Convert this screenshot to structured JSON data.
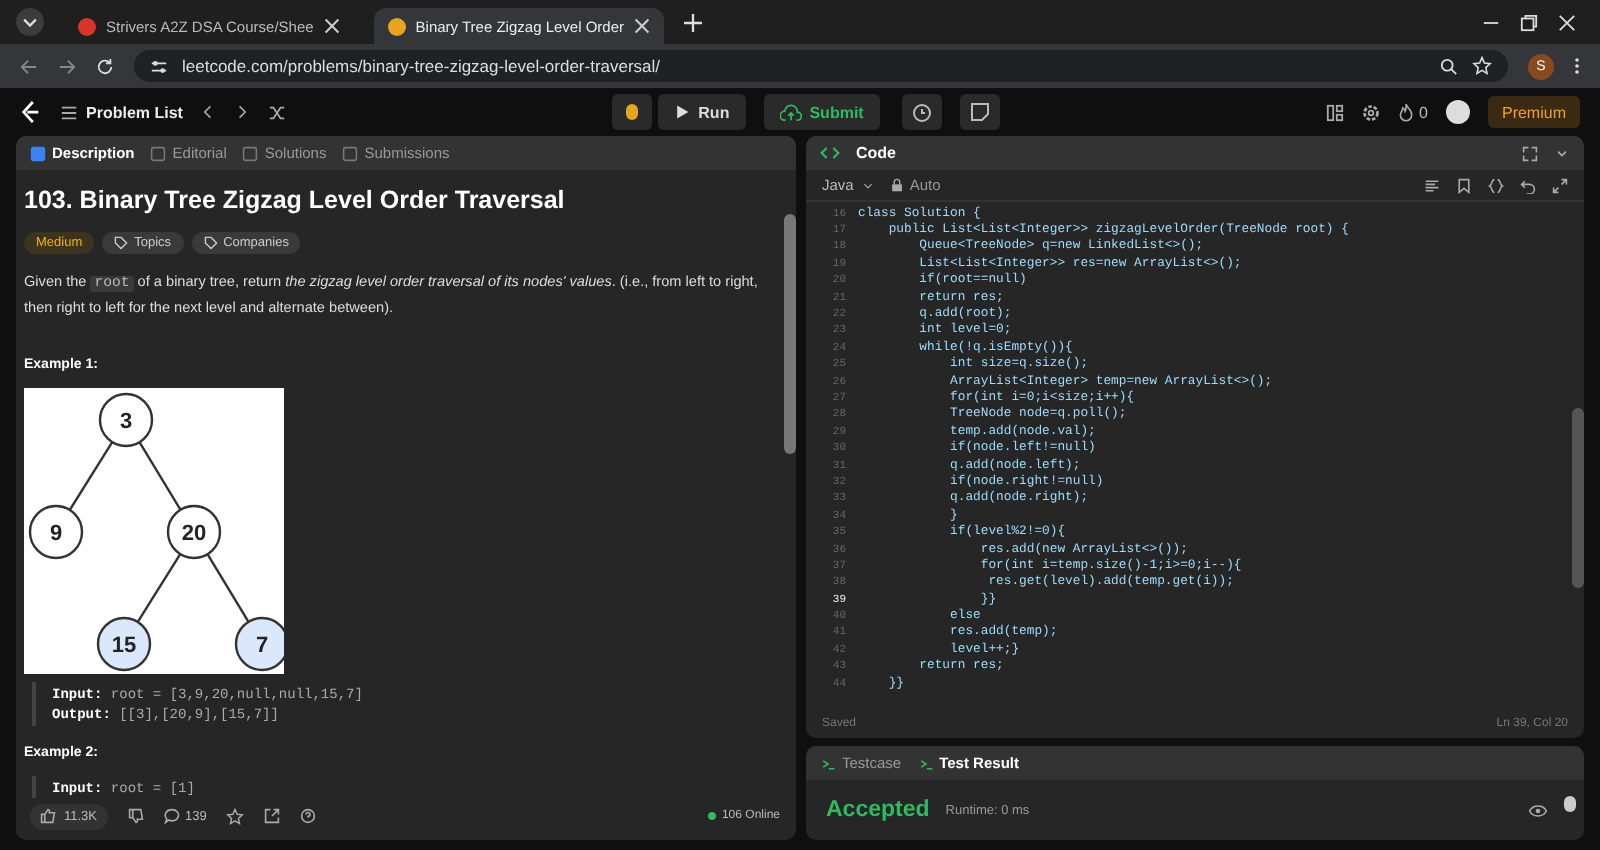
{
  "browser": {
    "tabs": [
      {
        "title": "Strivers A2Z DSA Course/Shee",
        "selected": false
      },
      {
        "title": "Binary Tree Zigzag Level Order",
        "selected": true
      }
    ],
    "url": "leetcode.com/problems/binary-tree-zigzag-level-order-traversal/",
    "profile": "S"
  },
  "topbar": {
    "problem_list": "Problem List",
    "run": "Run",
    "submit": "Submit",
    "streak": "0",
    "premium": "Premium"
  },
  "description": {
    "tabs": [
      {
        "label": "Description",
        "selected": true
      },
      {
        "label": "Editorial",
        "selected": false
      },
      {
        "label": "Solutions",
        "selected": false
      },
      {
        "label": "Submissions",
        "selected": false
      }
    ],
    "title": "103. Binary Tree Zigzag Level Order Traversal",
    "difficulty": "Medium",
    "tags": [
      "Topics",
      "Companies"
    ],
    "statement": [
      {
        "kind": "text",
        "text": "Given the "
      },
      {
        "kind": "code",
        "text": "root"
      },
      {
        "kind": "text",
        "text": " of a binary tree, return "
      },
      {
        "kind": "italic",
        "text": "the zigzag level order traversal of its nodes' values"
      },
      {
        "kind": "text",
        "text": ". (i.e., from left to right, then right to left for the next level and alternate between)."
      }
    ],
    "example1": {
      "label": "Example 1:",
      "tree": {
        "value": "3",
        "color": "#ffffff",
        "children": [
          {
            "value": "9",
            "color": "#ffffff"
          },
          {
            "value": "20",
            "color": "#ffffff",
            "children": [
              {
                "value": "15",
                "color": "#dbe8fb"
              },
              {
                "value": "7",
                "color": "#dbe8fb"
              }
            ]
          }
        ]
      },
      "lines": [
        {
          "label": "Input:",
          "value": "root = [3,9,20,null,null,15,7]"
        },
        {
          "label": "Output:",
          "value": "[[3],[20,9],[15,7]]"
        }
      ]
    },
    "example2": {
      "label": "Example 2:",
      "lines": [
        {
          "label": "Input:",
          "value": "root = [1]"
        }
      ]
    },
    "footer": {
      "likes": "11.3K",
      "comments": "139",
      "online": "106 Online"
    }
  },
  "code": {
    "title": "Code",
    "language": "Java",
    "mode": "Auto",
    "lines": [
      {
        "number": "16",
        "text": "class Solution {",
        "current": false
      },
      {
        "number": "17",
        "text": "    public List<List<Integer>> zigzagLevelOrder(TreeNode root) {",
        "current": false
      },
      {
        "number": "18",
        "text": "        Queue<TreeNode> q=new LinkedList<>();",
        "current": false
      },
      {
        "number": "19",
        "text": "        List<List<Integer>> res=new ArrayList<>();",
        "current": false
      },
      {
        "number": "20",
        "text": "        if(root==null)",
        "current": false
      },
      {
        "number": "21",
        "text": "        return res;",
        "current": false
      },
      {
        "number": "22",
        "text": "        q.add(root);",
        "current": false
      },
      {
        "number": "23",
        "text": "        int level=0;",
        "current": false
      },
      {
        "number": "24",
        "text": "        while(!q.isEmpty()){",
        "current": false
      },
      {
        "number": "25",
        "text": "            int size=q.size();",
        "current": false
      },
      {
        "number": "26",
        "text": "            ArrayList<Integer> temp=new ArrayList<>();",
        "current": false
      },
      {
        "number": "27",
        "text": "            for(int i=0;i<size;i++){",
        "current": false
      },
      {
        "number": "28",
        "text": "            TreeNode node=q.poll();",
        "current": false
      },
      {
        "number": "29",
        "text": "            temp.add(node.val);",
        "current": false
      },
      {
        "number": "30",
        "text": "            if(node.left!=null)",
        "current": false
      },
      {
        "number": "31",
        "text": "            q.add(node.left);",
        "current": false
      },
      {
        "number": "32",
        "text": "            if(node.right!=null)",
        "current": false
      },
      {
        "number": "33",
        "text": "            q.add(node.right);",
        "current": false
      },
      {
        "number": "34",
        "text": "            }",
        "current": false
      },
      {
        "number": "35",
        "text": "            if(level%2!=0){",
        "current": false
      },
      {
        "number": "36",
        "text": "                res.add(new ArrayList<>());",
        "current": false
      },
      {
        "number": "37",
        "text": "                for(int i=temp.size()-1;i>=0;i--){",
        "current": false
      },
      {
        "number": "38",
        "text": "                 res.get(level).add(temp.get(i));",
        "current": false
      },
      {
        "number": "39",
        "text": "                }}",
        "current": true
      },
      {
        "number": "40",
        "text": "            else",
        "current": false
      },
      {
        "number": "41",
        "text": "            res.add(temp);",
        "current": false
      },
      {
        "number": "42",
        "text": "            level++;}",
        "current": false
      },
      {
        "number": "43",
        "text": "        return res;",
        "current": false
      },
      {
        "number": "44",
        "text": "    }}",
        "current": false
      }
    ],
    "status": "Saved",
    "cursor": "Ln 39, Col 20"
  },
  "result": {
    "tabs": [
      {
        "label": "Testcase",
        "selected": false
      },
      {
        "label": "Test Result",
        "selected": true
      }
    ],
    "verdict": "Accepted",
    "runtime": "Runtime: 0 ms"
  }
}
